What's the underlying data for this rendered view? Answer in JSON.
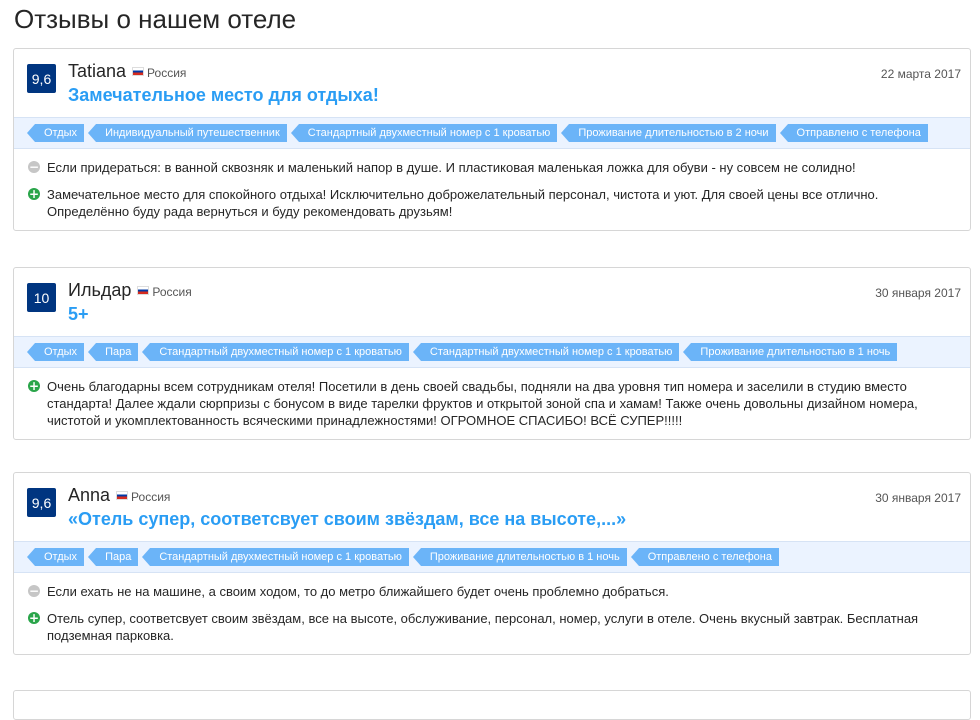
{
  "page": {
    "title": "Отзывы о нашем отеле"
  },
  "icons": {
    "negative": "minus-circle-icon",
    "positive": "plus-circle-icon",
    "flag": "russia-flag-icon"
  },
  "colors": {
    "score_bg": "#003580",
    "title": "#2a9df4",
    "tag_bg": "#6bb4f8",
    "tag_band": "#ebf3ff",
    "positive": "#2aa54a",
    "negative": "#c6c6c6"
  },
  "reviews": [
    {
      "score": "9,6",
      "name": "Tatiana",
      "country": "Россия",
      "title": "Замечательное место для отдыха!",
      "date": "22 марта 2017",
      "tags": [
        "Отдых",
        "Индивидуальный путешественник",
        "Стандартный двухместный номер с 1 кроватью",
        "Проживание длительностью в 2 ночи",
        "Отправлено с телефона"
      ],
      "negative": "Если придераться: в ванной сквозняк и маленький напор в душе. И пластиковая маленькая ложка для обуви - ну совсем не солидно!",
      "positive": "Замечательное место для спокойного отдыха! Исключительно доброжелательный персонал, чистота и уют. Для своей цены все отлично. Определённо буду рада вернуться и буду рекомендовать друзьям!"
    },
    {
      "score": "10",
      "name": "Ильдар",
      "country": "Россия",
      "title": "5+",
      "date": "30 января 2017",
      "tags": [
        "Отдых",
        "Пара",
        "Стандартный двухместный номер с 1 кроватью",
        "Стандартный двухместный номер с 1 кроватью",
        "Проживание длительностью в 1 ночь"
      ],
      "positive": "Очень благодарны всем сотрудникам отеля! Посетили в день своей свадьбы, подняли на два уровня тип номера и заселили в студию вместо стандарта! Далее ждали сюрпризы с бонусом в виде тарелки фруктов и открытой зоной спа и хамам! Также очень довольны дизайном номера, чистотой и укомплектованность всяческими принадлежностями! ОГРОМНОЕ СПАСИБО! ВСЁ СУПЕР!!!!!"
    },
    {
      "score": "9,6",
      "name": "Anna",
      "country": "Россия",
      "title": "«Отель супер, соответсвует своим звёздам, все на высоте,...»",
      "date": "30 января 2017",
      "tags": [
        "Отдых",
        "Пара",
        "Стандартный двухместный номер с 1 кроватью",
        "Проживание длительностью в 1 ночь",
        "Отправлено с телефона"
      ],
      "negative": "Если ехать не на машине, а своим ходом, то до метро ближайшего будет очень проблемно добраться.",
      "positive": "Отель супер, соответсвует своим звёздам, все на высоте, обслуживание, персонал, номер, услуги в отеле. Очень вкусный завтрак. Бесплатная подземная парковка."
    }
  ]
}
